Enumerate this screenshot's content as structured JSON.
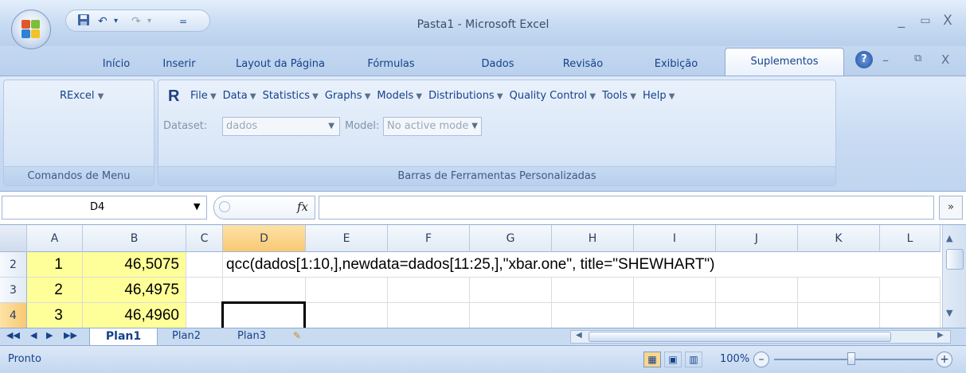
{
  "window": {
    "title": "Pasta1 - Microsoft Excel",
    "minimize": "_",
    "maximize": "▭",
    "close": "X"
  },
  "qat": {
    "undo_arrow": "▾",
    "redo_arrow": "▾",
    "customize": "="
  },
  "tabs": [
    "Início",
    "Inserir",
    "Layout da Página",
    "Fórmulas",
    "Dados",
    "Revisão",
    "Exibição"
  ],
  "active_tab": "Suplementos",
  "ribbon": {
    "rexcel_menu": "RExcel",
    "group1_label": "Comandos de Menu",
    "group2_label": "Barras de Ferramentas Personalizadas",
    "r_logo": "R",
    "menus": [
      "File",
      "Data",
      "Statistics",
      "Graphs",
      "Models",
      "Distributions",
      "Quality Control",
      "Tools",
      "Help"
    ],
    "dataset_label": "Dataset:",
    "dataset_value": "dados",
    "model_label": "Model:",
    "model_value": "No active mode"
  },
  "formula_bar": {
    "name_box": "D4",
    "fx": "fx",
    "content": ""
  },
  "grid": {
    "columns": [
      "A",
      "B",
      "C",
      "D",
      "E",
      "F",
      "G",
      "H",
      "I",
      "J",
      "K",
      "L"
    ],
    "rows": [
      {
        "num": "2",
        "a": "1",
        "b": "46,5075",
        "d": "qcc(dados[1:10,],newdata=dados[11:25,],\"xbar.one\", title=\"SHEWHART\")"
      },
      {
        "num": "3",
        "a": "2",
        "b": "46,4975",
        "d": ""
      },
      {
        "num": "4",
        "a": "3",
        "b": "46,4960",
        "d": ""
      }
    ]
  },
  "sheets": {
    "active": "Plan1",
    "others": [
      "Plan2",
      "Plan3"
    ]
  },
  "status": {
    "text": "Pronto",
    "zoom": "100%"
  },
  "colors": {
    "highlight_cells": "#ffff99",
    "selected_header": "#f9c874"
  }
}
